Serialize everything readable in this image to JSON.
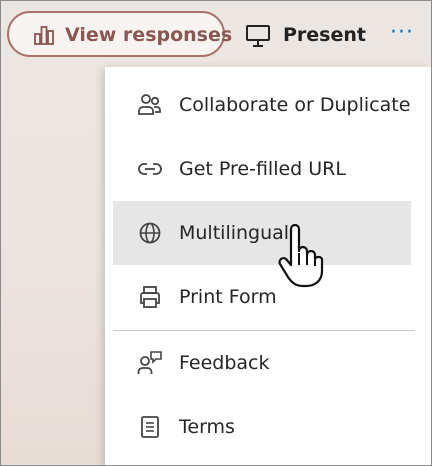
{
  "toolbar": {
    "view_responses_label": "View responses",
    "view_responses_icon": "bar-chart-icon",
    "present_label": "Present",
    "present_icon": "presentation-screen-icon",
    "more_label": "···",
    "accent_color": "#8a5751",
    "link_color": "#1a6fb5"
  },
  "menu": {
    "items": [
      {
        "label": "Collaborate or Duplicate",
        "icon": "people-icon"
      },
      {
        "label": "Get Pre-filled URL",
        "icon": "link-icon"
      },
      {
        "label": "Multilingual",
        "icon": "globe-icon",
        "highlighted": true
      },
      {
        "label": "Print Form",
        "icon": "printer-icon"
      },
      {
        "label": "Feedback",
        "icon": "feedback-icon"
      },
      {
        "label": "Terms",
        "icon": "document-icon"
      }
    ],
    "highlight_color": "#e6e6e6"
  },
  "cursor": {
    "icon": "hand-pointer-icon"
  }
}
